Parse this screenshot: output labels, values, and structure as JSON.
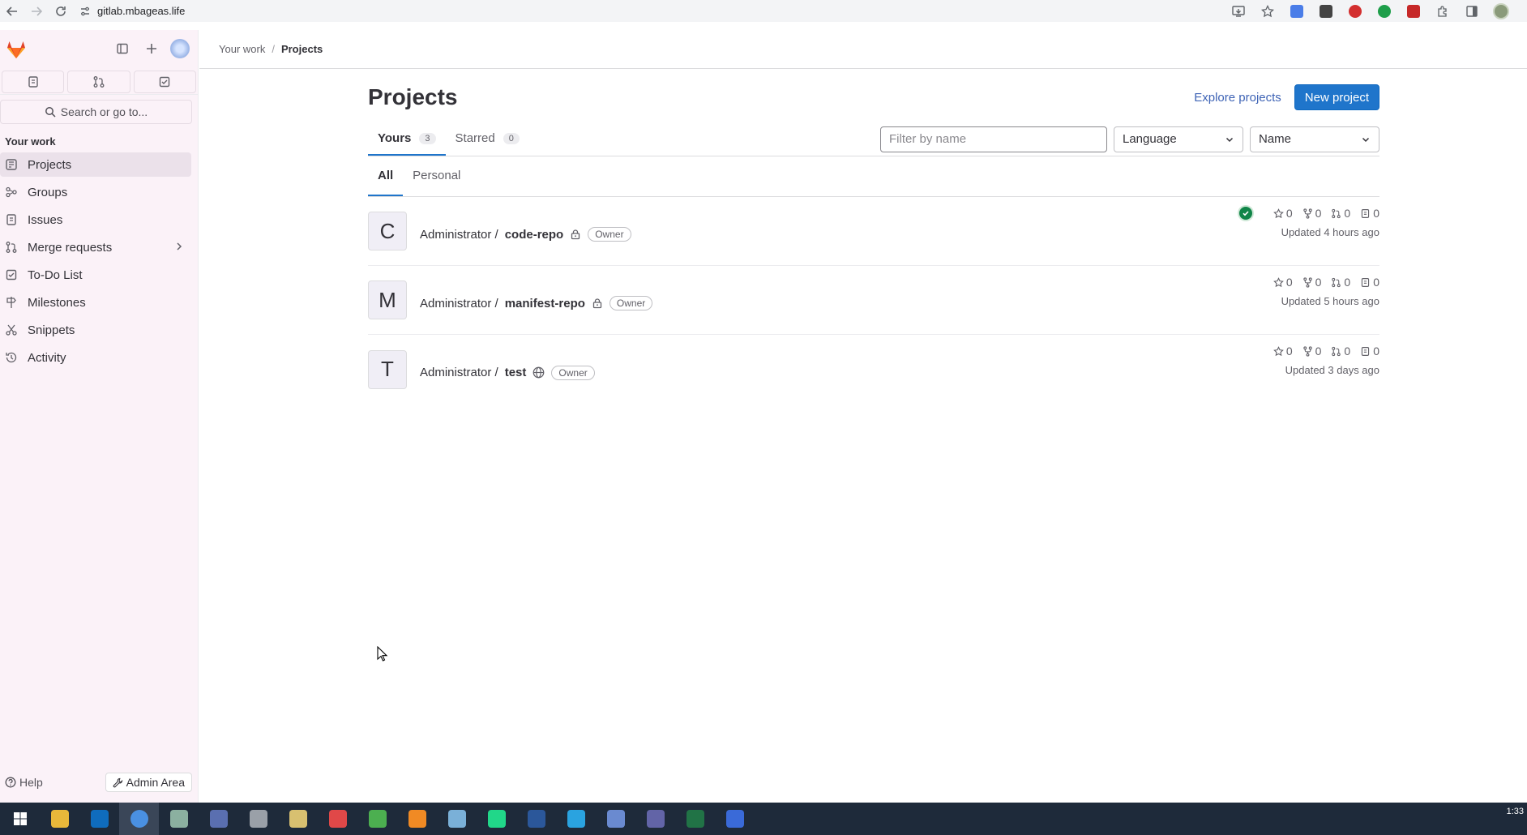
{
  "browser": {
    "url": "gitlab.mbageas.life",
    "extension_colors": [
      "#4a7de8",
      "#444444",
      "#d32f2f",
      "#1e9e4a",
      "#c62828",
      "#555555",
      "#555555"
    ]
  },
  "sidebar": {
    "section_title": "Your work",
    "search_placeholder": "Search or go to...",
    "items": [
      {
        "label": "Projects",
        "icon": "project-icon"
      },
      {
        "label": "Groups",
        "icon": "group-icon"
      },
      {
        "label": "Issues",
        "icon": "issues-icon"
      },
      {
        "label": "Merge requests",
        "icon": "merge-request-icon"
      },
      {
        "label": "To-Do List",
        "icon": "todo-icon"
      },
      {
        "label": "Milestones",
        "icon": "milestone-icon"
      },
      {
        "label": "Snippets",
        "icon": "snippet-icon"
      },
      {
        "label": "Activity",
        "icon": "history-icon"
      }
    ],
    "help_label": "Help",
    "admin_label": "Admin Area"
  },
  "breadcrumb": {
    "parent": "Your work",
    "current": "Projects"
  },
  "main": {
    "title": "Projects",
    "explore_label": "Explore projects",
    "new_project_label": "New project",
    "tabs": [
      {
        "label": "Yours",
        "count": "3"
      },
      {
        "label": "Starred",
        "count": "0"
      }
    ],
    "filter_placeholder": "Filter by name",
    "language_dropdown": "Language",
    "sort_dropdown": "Name",
    "subtabs": [
      "All",
      "Personal"
    ],
    "projects": [
      {
        "avatar": "C",
        "namespace": "Administrator /",
        "name": "code-repo",
        "visibility": "private",
        "role": "Owner",
        "stars": "0",
        "forks": "0",
        "merge_requests": "0",
        "issues": "0",
        "updated": "Updated 4 hours ago",
        "pipeline": "passed"
      },
      {
        "avatar": "M",
        "namespace": "Administrator /",
        "name": "manifest-repo",
        "visibility": "private",
        "role": "Owner",
        "stars": "0",
        "forks": "0",
        "merge_requests": "0",
        "issues": "0",
        "updated": "Updated 5 hours ago"
      },
      {
        "avatar": "T",
        "namespace": "Administrator /",
        "name": "test",
        "visibility": "public",
        "role": "Owner",
        "stars": "0",
        "forks": "0",
        "merge_requests": "0",
        "issues": "0",
        "updated": "Updated 3 days ago"
      }
    ]
  },
  "taskbar": {
    "clock_time": "1:33",
    "apps": [
      {
        "name": "file-explorer",
        "color": "#e8b83a"
      },
      {
        "name": "outlook",
        "color": "#0f6cbd"
      },
      {
        "name": "chrome",
        "color": "#4a90e2"
      },
      {
        "name": "app-4",
        "color": "#8bb0a0"
      },
      {
        "name": "app-5",
        "color": "#5a6fb0"
      },
      {
        "name": "app-6",
        "color": "#9aa0a8"
      },
      {
        "name": "app-7",
        "color": "#d8c070"
      },
      {
        "name": "app-8",
        "color": "#e04848"
      },
      {
        "name": "app-9",
        "color": "#4caf50"
      },
      {
        "name": "app-10",
        "color": "#f08a24"
      },
      {
        "name": "app-11",
        "color": "#7ab0d8"
      },
      {
        "name": "pycharm",
        "color": "#21d789"
      },
      {
        "name": "word",
        "color": "#2b579a"
      },
      {
        "name": "telegram",
        "color": "#2aa3e0"
      },
      {
        "name": "app-15",
        "color": "#6a8ad0"
      },
      {
        "name": "teams",
        "color": "#6264a7"
      },
      {
        "name": "excel",
        "color": "#217346"
      },
      {
        "name": "app-18",
        "color": "#3a6ad8"
      }
    ]
  }
}
